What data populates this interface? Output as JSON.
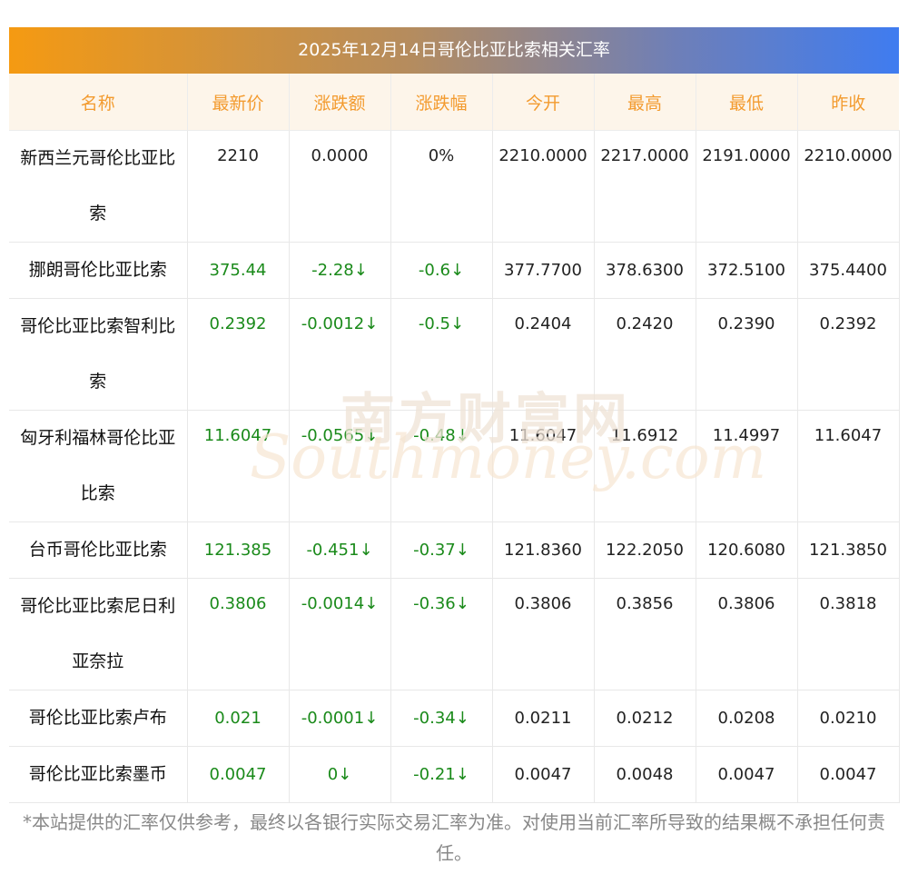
{
  "title": "2025年12月14日哥伦比亚比索相关汇率",
  "headers": [
    "名称",
    "最新价",
    "涨跌额",
    "涨跌幅",
    "今开",
    "最高",
    "最低",
    "昨收"
  ],
  "rows": [
    {
      "name": "新西兰元哥伦比亚比索",
      "latest": "2210",
      "change": "0.0000",
      "pct": "0%",
      "open": "2210.0000",
      "high": "2217.0000",
      "low": "2191.0000",
      "prev": "2210.0000",
      "dir": "flat"
    },
    {
      "name": "挪朗哥伦比亚比索",
      "latest": "375.44",
      "change": "-2.28↓",
      "pct": "-0.6↓",
      "open": "377.7700",
      "high": "378.6300",
      "low": "372.5100",
      "prev": "375.4400",
      "dir": "down"
    },
    {
      "name": "哥伦比亚比索智利比索",
      "latest": "0.2392",
      "change": "-0.0012↓",
      "pct": "-0.5↓",
      "open": "0.2404",
      "high": "0.2420",
      "low": "0.2390",
      "prev": "0.2392",
      "dir": "down"
    },
    {
      "name": "匈牙利福林哥伦比亚比索",
      "latest": "11.6047",
      "change": "-0.0565↓",
      "pct": "-0.48↓",
      "open": "11.6047",
      "high": "11.6912",
      "low": "11.4997",
      "prev": "11.6047",
      "dir": "down"
    },
    {
      "name": "台币哥伦比亚比索",
      "latest": "121.385",
      "change": "-0.451↓",
      "pct": "-0.37↓",
      "open": "121.8360",
      "high": "122.2050",
      "low": "120.6080",
      "prev": "121.3850",
      "dir": "down"
    },
    {
      "name": "哥伦比亚比索尼日利亚奈拉",
      "latest": "0.3806",
      "change": "-0.0014↓",
      "pct": "-0.36↓",
      "open": "0.3806",
      "high": "0.3856",
      "low": "0.3806",
      "prev": "0.3818",
      "dir": "down"
    },
    {
      "name": "哥伦比亚比索卢布",
      "latest": "0.021",
      "change": "-0.0001↓",
      "pct": "-0.34↓",
      "open": "0.0211",
      "high": "0.0212",
      "low": "0.0208",
      "prev": "0.0210",
      "dir": "down"
    },
    {
      "name": "哥伦比亚比索墨币",
      "latest": "0.0047",
      "change": "0↓",
      "pct": "-0.21↓",
      "open": "0.0047",
      "high": "0.0048",
      "low": "0.0047",
      "prev": "0.0047",
      "dir": "down"
    }
  ],
  "watermark": {
    "cn": "南方财富网",
    "en": "Southmoney.com"
  },
  "note": "*本站提供的汇率仅供参考，最终以各银行实际交易汇率为准。对使用当前汇率所导致的结果概不承担任何责任。",
  "colors": {
    "header_text": "#f39b2f",
    "header_bg": "#fdf5ea",
    "down": "#1a8a1a",
    "title_start": "#f59a12",
    "title_end": "#3f7cf0"
  }
}
